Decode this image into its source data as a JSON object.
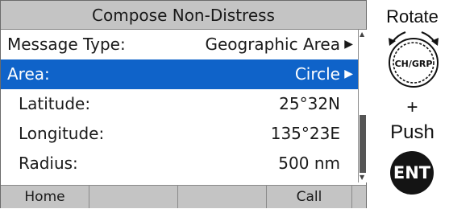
{
  "screen": {
    "title": "Compose Non-Distress",
    "rows": [
      {
        "label": "Message Type:",
        "value": "Geographic Area",
        "arrow": "▶"
      },
      {
        "label": "Area:",
        "value": "Circle",
        "arrow": "▶"
      },
      {
        "label": "Latitude:",
        "value": "25°32N"
      },
      {
        "label": "Longitude:",
        "value": "135°23E"
      },
      {
        "label": "Radius:",
        "value": "500 nm"
      }
    ],
    "scrollbar": {
      "up": "▲",
      "down": "▼"
    },
    "softkeys": [
      "Home",
      "",
      "",
      "Call",
      ""
    ]
  },
  "hint": {
    "rotate": "Rotate",
    "knob_label": "CH/GRP",
    "plus": "+",
    "push": "Push",
    "ent": "ENT"
  },
  "colors": {
    "selection": "#0f63c9",
    "bar": "#c4c4c4"
  }
}
